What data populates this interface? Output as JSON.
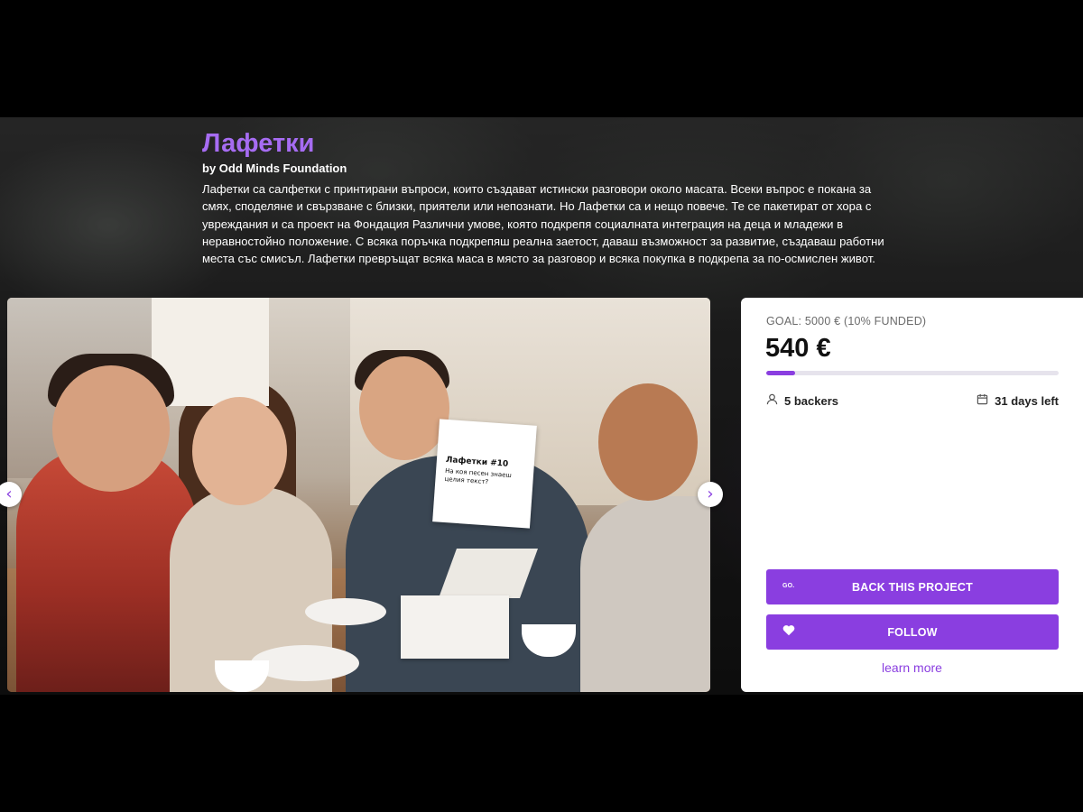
{
  "project": {
    "title": "Лафетки",
    "byline": "by Odd Minds Foundation",
    "description": "Лафетки са салфетки с принтирани въпроси, които създават истински разговори около масата. Всеки въпрос е покана за смях, споделяне и свързване с близки, приятели или непознати. Но Лафетки са и нещо повече. Те се пакетират от хора с увреждания и са проект на Фондация Различни умове, която подкрепя социалната интеграция на деца и младежи в неравностойно положение. С всяка поръчка подкрепяш реална заетост, даваш възможност за развитие, създаваш работни места със смисъл. Лафетки превръщат всяка маса в място за разговор и всяка покупка в подкрепа за по-осмислен живот."
  },
  "photo": {
    "card_title": "Лафетки #10",
    "card_question": "На коя песен знаеш целия текст?"
  },
  "funding": {
    "goal_text": "GOAL: 5000 € (10% FUNDED)",
    "amount": "540 €",
    "progress_fraction": 0.1,
    "backers": "5 backers",
    "days_left": "31 days left"
  },
  "actions": {
    "back_icon_text": "GO.",
    "back_label": "BACK THIS PROJECT",
    "follow_label": "FOLLOW",
    "learn_more": "learn more"
  },
  "icons": {
    "prev": "chevron-left-icon",
    "next": "chevron-right-icon",
    "backers": "user-icon",
    "days": "calendar-icon",
    "follow": "heart-icon"
  },
  "colors": {
    "accent": "#8a3ee0",
    "title": "#a66cf2"
  }
}
